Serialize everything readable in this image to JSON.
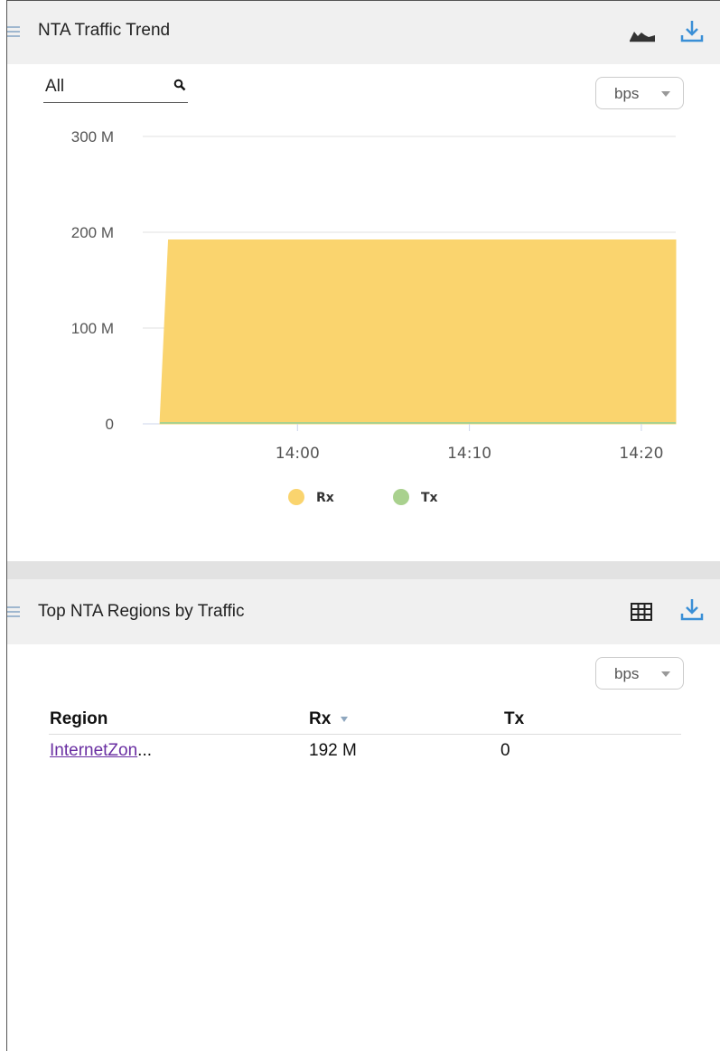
{
  "trend_panel": {
    "title": "NTA Traffic Trend",
    "selector_value": "All",
    "unit_label": "bps",
    "icons": [
      "area-chart-icon",
      "download-icon",
      "search-icon",
      "menu-icon"
    ]
  },
  "chart_data": {
    "type": "area",
    "x_ticks": [
      "14:00",
      "14:10",
      "14:20"
    ],
    "y_ticks": [
      "300 M",
      "200 M",
      "100 M",
      "0"
    ],
    "ylim": [
      0,
      300
    ],
    "y_unit": "M",
    "series": [
      {
        "name": "Rx",
        "color": "#fad46e",
        "x": [
          "13:52",
          "13:52:30",
          "14:22"
        ],
        "values": [
          0,
          192,
          192
        ]
      },
      {
        "name": "Tx",
        "color": "#a9d18e",
        "x": [
          "13:52",
          "14:22"
        ],
        "values": [
          0,
          0
        ]
      }
    ],
    "legend": [
      "Rx",
      "Tx"
    ],
    "legend_position": "bottom",
    "grid": true
  },
  "regions_panel": {
    "title": "Top NTA Regions by Traffic",
    "unit_label": "bps",
    "columns": [
      "Region",
      "Rx",
      "Tx"
    ],
    "sort_column": "Rx",
    "rows": [
      {
        "region_link": "InternetZon",
        "region_ellipsis": "...",
        "rx": "192 M",
        "tx": "0"
      }
    ],
    "icons": [
      "table-icon",
      "download-icon",
      "menu-icon"
    ]
  }
}
